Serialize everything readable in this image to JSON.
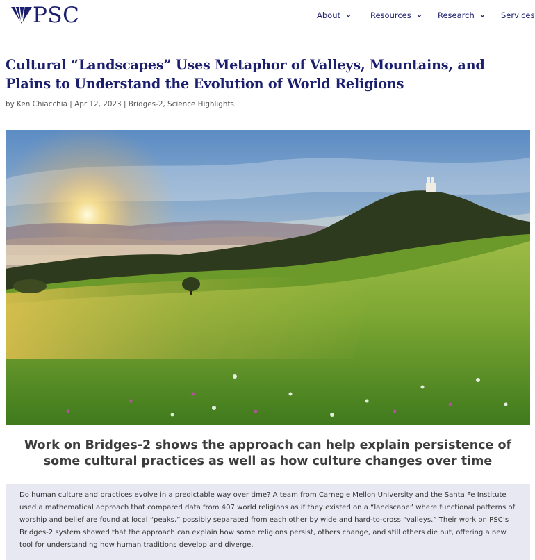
{
  "header": {
    "logo_text": "PSC",
    "nav": [
      {
        "label": "About"
      },
      {
        "label": "Resources"
      },
      {
        "label": "Research"
      },
      {
        "label": "Services"
      }
    ]
  },
  "article": {
    "title": "Cultural “Landscapes” Uses Metaphor of Valleys, Mountains, and Plains to Understand the Evolution of World Religions",
    "meta": {
      "by": "by ",
      "author": "Ken Chiacchia",
      "sep1": " | ",
      "date": "Apr 12, 2023",
      "sep2": " | ",
      "category1": "Bridges-2",
      "comma": ", ",
      "category2": "Science Highlights"
    },
    "subtitle": "Work on Bridges-2 shows the approach can help explain persistence of some cultural practices as well as how culture changes over time",
    "summary": "Do human culture and practices evolve in a predictable way over time? A team from Carnegie Mellon University and the Santa Fe Institute used a mathematical approach that compared data from 407 world religions as if they existed on a “landscape” where functional patterns of worship and belief are found at local “peaks,” possibly separated from each other by wide and hard-to-cross “valleys.” Their work on PSC’s Bridges-2 system showed that the approach can explain how some religions persist, others change, and still others die out, offering a new tool for understanding how human traditions develop and diverge."
  },
  "colors": {
    "brand_navy": "#1b1f6e",
    "summary_bg": "#e8e8f3"
  },
  "icons": {
    "logo": "psc-shield-logo-icon",
    "chevron": "chevron-down-icon"
  }
}
